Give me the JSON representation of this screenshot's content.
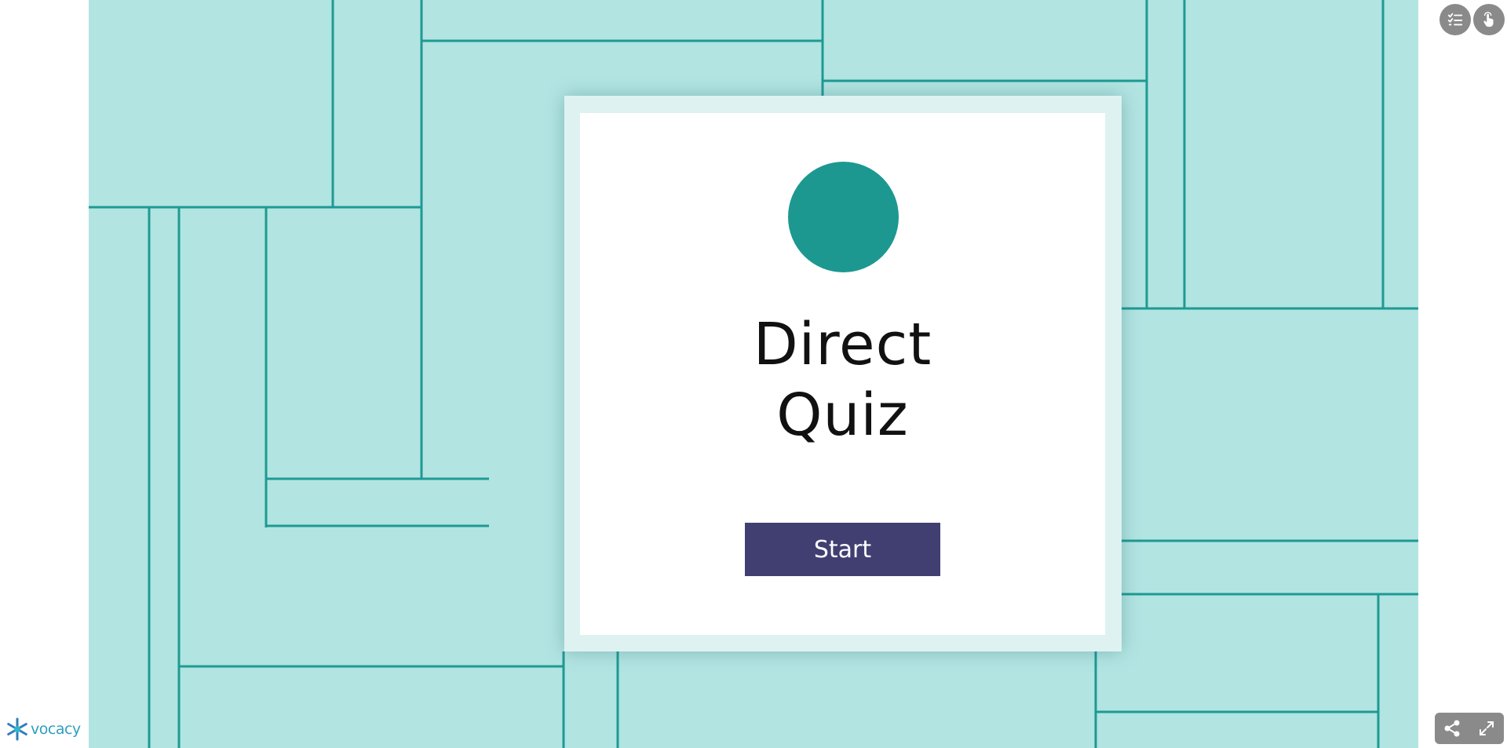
{
  "quiz": {
    "title_line1": "Direct",
    "title_line2": "Quiz",
    "start_label": "Start"
  },
  "brand": {
    "name": "vocacy"
  },
  "icons": {
    "top_left": "checklist-icon",
    "top_right": "touch-hand-icon",
    "bottom_left": "share-icon",
    "bottom_right": "fullscreen-icon"
  },
  "colors": {
    "background": "#b2e4e2",
    "lines": "#1e9a93",
    "circle": "#1c9891",
    "button": "#413f72",
    "card_border": "#def2f1",
    "control": "#8a8a8a"
  }
}
